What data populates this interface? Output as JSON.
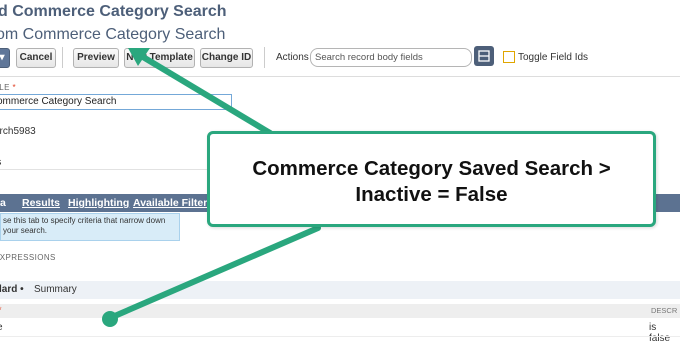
{
  "header": {
    "title": "d Commerce Category Search",
    "subtitle": "om Commerce Category Search"
  },
  "toolbar": {
    "cancel_label": "Cancel",
    "preview_label": "Preview",
    "new_template_label": "New Template",
    "change_id_label": "Change ID",
    "actions_label": "Actions",
    "search_placeholder": "Search record body fields",
    "toggle_label": "Toggle Field Ids"
  },
  "form": {
    "title_label": "TLE",
    "title_value": "ommerce Category Search",
    "id_value": "arch5983",
    "field_a": "ls",
    "field_b": "c"
  },
  "tabs": [
    "a",
    "Results",
    "Highlighting",
    "Available Filters"
  ],
  "help_text": "se this tab to specify criteria that narrow down your search.",
  "expressions_label": "EXPRESSIONS",
  "subtabs": {
    "standard": "lard",
    "summary": "Summary"
  },
  "table": {
    "description_header": "DESCR",
    "row_value": "e",
    "row_description": "is false"
  },
  "callout": {
    "line1": "Commerce Category Saved Search >",
    "line2": "Inactive = False",
    "border_color": "#2aa77e"
  },
  "colors": {
    "accent": "#5c7291",
    "annotation": "#2aa77e"
  }
}
